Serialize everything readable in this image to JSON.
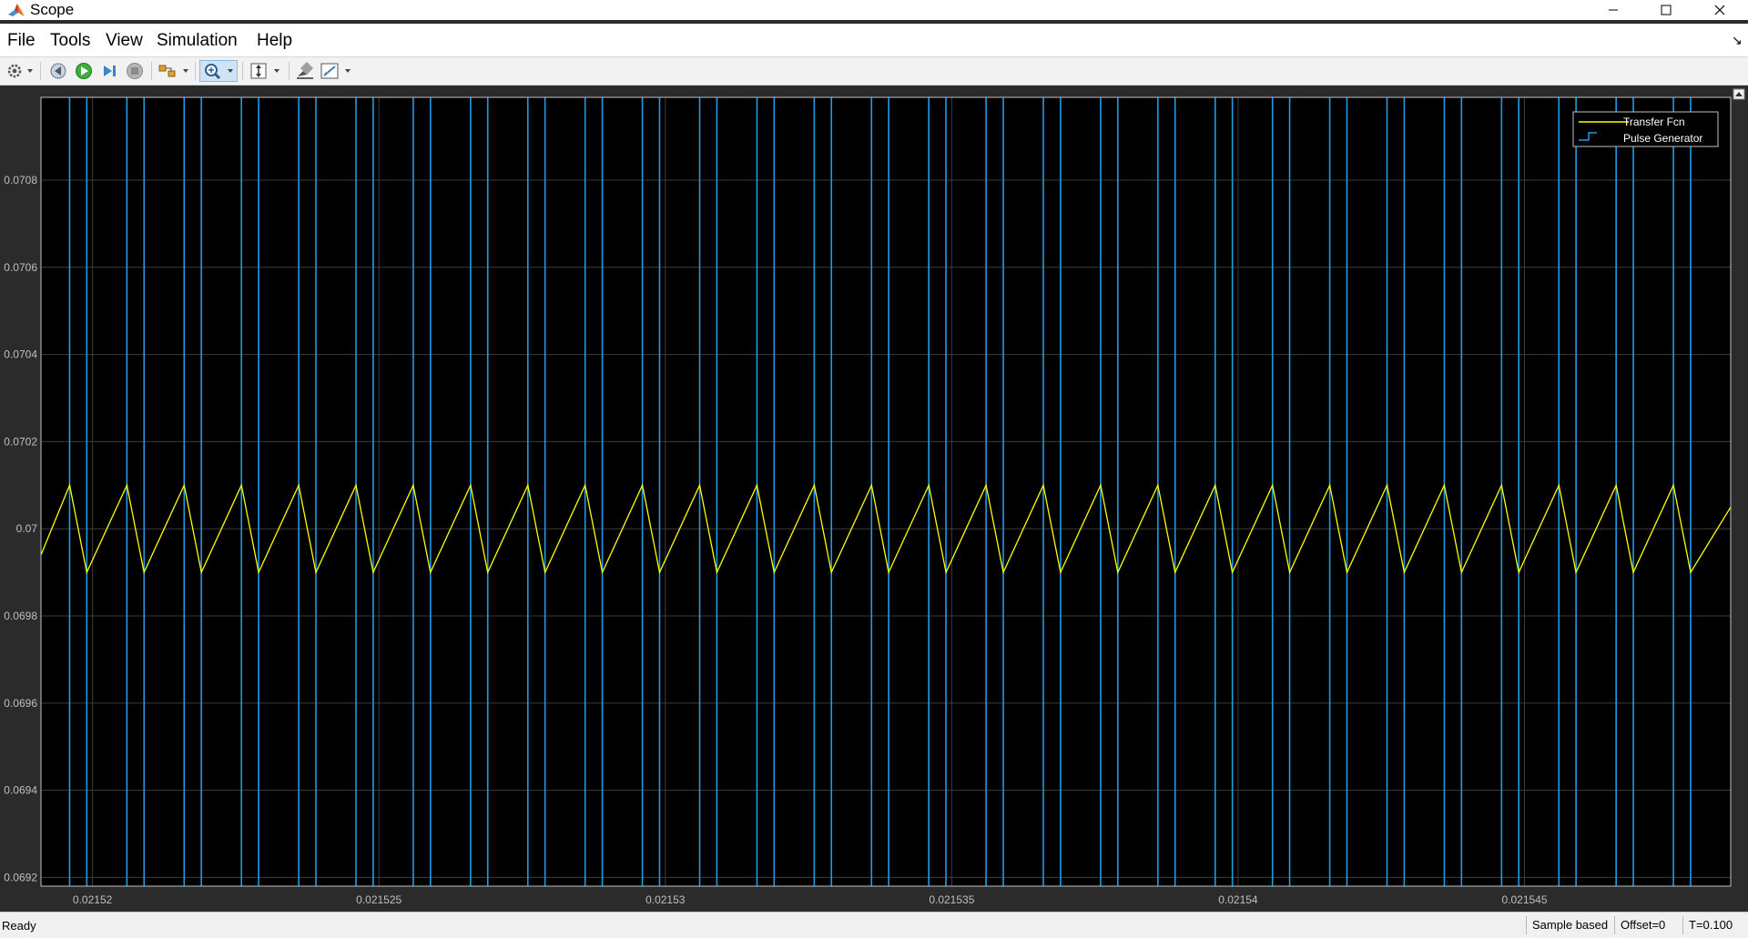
{
  "window": {
    "title": "Scope",
    "controls": [
      "minimize-icon",
      "maximize-icon",
      "close-icon"
    ]
  },
  "menu": [
    "File",
    "Tools",
    "View",
    "Simulation",
    "Help"
  ],
  "toolbar": {
    "icons": [
      "settings-icon",
      "step-back-icon",
      "run-icon",
      "step-forward-icon",
      "stop-icon",
      "highlight-block-icon",
      "zoom-icon",
      "scale-axes-icon",
      "cursor-measure-icon",
      "style-icon"
    ]
  },
  "status": {
    "ready": "Ready",
    "sample_mode": "Sample based",
    "offset": "Offset=0",
    "time": "T=0.100"
  },
  "chart_data": {
    "type": "line",
    "grid": true,
    "legend_position": "top-right",
    "xlim": [
      0.0215191,
      0.0215486
    ],
    "ylim": [
      0.06918,
      0.07099
    ],
    "x_ticks": [
      0.02152,
      0.021525,
      0.02153,
      0.021535,
      0.02154,
      0.021545
    ],
    "x_tick_labels": [
      "0.02152",
      "0.021525",
      "0.02153",
      "0.021535",
      "0.02154",
      "0.021545"
    ],
    "y_ticks": [
      0.0692,
      0.0694,
      0.0696,
      0.0698,
      0.07,
      0.0702,
      0.0704,
      0.0706,
      0.0708
    ],
    "y_tick_labels": [
      "0.0692",
      "0.0694",
      "0.0696",
      "0.0698",
      "0.07",
      "0.0702",
      "0.0704",
      "0.0706",
      "0.0708"
    ],
    "colors": {
      "background": "#000000",
      "grid": "#3d3d3d",
      "axes": "#bfbfbf",
      "transfer": "#ffff00",
      "pulse": "#1e9be8"
    },
    "series": [
      {
        "name": "Transfer Fcn",
        "x": [
          0.0215191,
          0.0215196,
          0.0215199,
          0.0215206,
          0.0215209,
          0.0215216,
          0.0215219,
          0.0215226,
          0.0215229,
          0.0215236,
          0.0215239,
          0.0215246,
          0.0215249,
          0.0215256,
          0.0215259,
          0.0215266,
          0.0215269,
          0.0215276,
          0.0215279,
          0.0215286,
          0.0215289,
          0.0215296,
          0.0215299,
          0.0215306,
          0.0215309,
          0.0215316,
          0.0215319,
          0.0215326,
          0.0215329,
          0.0215336,
          0.0215339,
          0.0215346,
          0.0215349,
          0.0215356,
          0.0215359,
          0.0215366,
          0.0215369,
          0.0215376,
          0.0215379,
          0.0215386,
          0.0215389,
          0.0215396,
          0.0215399,
          0.0215406,
          0.0215409,
          0.0215416,
          0.0215419,
          0.0215426,
          0.0215429,
          0.0215436,
          0.0215439,
          0.0215446,
          0.0215449,
          0.0215456,
          0.0215459,
          0.0215466,
          0.0215469,
          0.0215476,
          0.0215479,
          0.0215486
        ],
        "y": [
          0.06994,
          0.0701,
          0.0699,
          0.0701,
          0.0699,
          0.0701,
          0.0699,
          0.0701,
          0.0699,
          0.0701,
          0.0699,
          0.0701,
          0.0699,
          0.0701,
          0.0699,
          0.0701,
          0.0699,
          0.0701,
          0.0699,
          0.0701,
          0.0699,
          0.0701,
          0.0699,
          0.0701,
          0.0699,
          0.0701,
          0.0699,
          0.0701,
          0.0699,
          0.0701,
          0.0699,
          0.0701,
          0.0699,
          0.0701,
          0.0699,
          0.0701,
          0.0699,
          0.0701,
          0.0699,
          0.0701,
          0.0699,
          0.0701,
          0.0699,
          0.0701,
          0.0699,
          0.0701,
          0.0699,
          0.0701,
          0.0699,
          0.0701,
          0.0699,
          0.0701,
          0.0699,
          0.0701,
          0.0699,
          0.0701,
          0.0699,
          0.0701,
          0.0699,
          0.07005
        ]
      },
      {
        "name": "Pulse Generator",
        "edges_x": [
          0.0215196,
          0.0215199,
          0.0215206,
          0.0215209,
          0.0215216,
          0.0215219,
          0.0215226,
          0.0215229,
          0.0215236,
          0.0215239,
          0.0215246,
          0.0215249,
          0.0215256,
          0.0215259,
          0.0215266,
          0.0215269,
          0.0215276,
          0.0215279,
          0.0215286,
          0.0215289,
          0.0215296,
          0.0215299,
          0.0215306,
          0.0215309,
          0.0215316,
          0.0215319,
          0.0215326,
          0.0215329,
          0.0215336,
          0.0215339,
          0.0215346,
          0.0215349,
          0.0215356,
          0.0215359,
          0.0215366,
          0.0215369,
          0.0215376,
          0.0215379,
          0.0215386,
          0.0215389,
          0.0215396,
          0.0215399,
          0.0215406,
          0.0215409,
          0.0215416,
          0.0215419,
          0.0215426,
          0.0215429,
          0.0215436,
          0.0215439,
          0.0215446,
          0.0215449,
          0.0215456,
          0.0215459,
          0.0215466,
          0.0215469,
          0.0215476,
          0.0215479
        ]
      }
    ]
  }
}
